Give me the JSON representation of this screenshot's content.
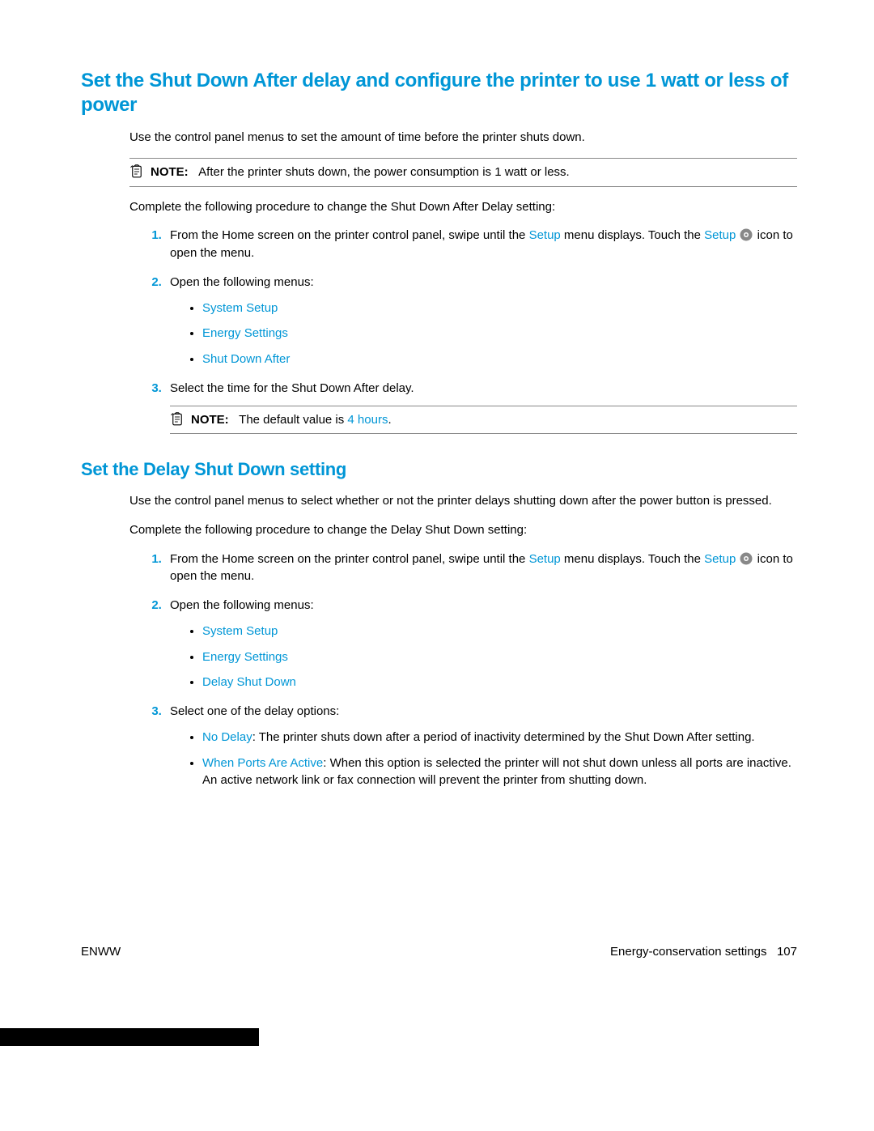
{
  "section1": {
    "title": "Set the Shut Down After delay and configure the printer to use 1 watt or less of power",
    "intro": "Use the control panel menus to set the amount of time before the printer shuts down.",
    "note1_label": "NOTE:   ",
    "note1_text": "After the printer shuts down, the power consumption is 1 watt or less.",
    "procedure_intro": "Complete the following procedure to change the Shut Down After Delay setting:",
    "step1_pre": "From the Home screen on the printer control panel, swipe until the ",
    "step1_setup1": "Setup",
    "step1_mid": " menu displays. Touch the ",
    "step1_setup2": "Setup",
    "step1_post": " icon to open the menu.",
    "step2": "Open the following menus:",
    "menu1": "System Setup",
    "menu2": "Energy Settings",
    "menu3": "Shut Down After",
    "step3": "Select the time for the Shut Down After delay.",
    "note2_label": "NOTE:   ",
    "note2_pre": "The default value is ",
    "note2_val": "4 hours",
    "note2_post": "."
  },
  "section2": {
    "title": "Set the Delay Shut Down setting",
    "intro": "Use the control panel menus to select whether or not the printer delays shutting down after the power button is pressed.",
    "procedure_intro": "Complete the following procedure to change the Delay Shut Down setting:",
    "step1_pre": "From the Home screen on the printer control panel, swipe until the ",
    "step1_setup1": "Setup",
    "step1_mid": " menu displays. Touch the ",
    "step1_setup2": "Setup",
    "step1_post": " icon to open the menu.",
    "step2": "Open the following menus:",
    "menu1": "System Setup",
    "menu2": "Energy Settings",
    "menu3": "Delay Shut Down",
    "step3": "Select one of the delay options:",
    "opt1_label": "No Delay",
    "opt1_text": ": The printer shuts down after a period of inactivity determined by the Shut Down After setting.",
    "opt2_label": "When Ports Are Active",
    "opt2_text": ": When this option is selected the printer will not shut down unless all ports are inactive. An active network link or fax connection will prevent the printer from shutting down."
  },
  "footer": {
    "left": "ENWW",
    "right_text": "Energy-conservation settings",
    "page": "107"
  }
}
